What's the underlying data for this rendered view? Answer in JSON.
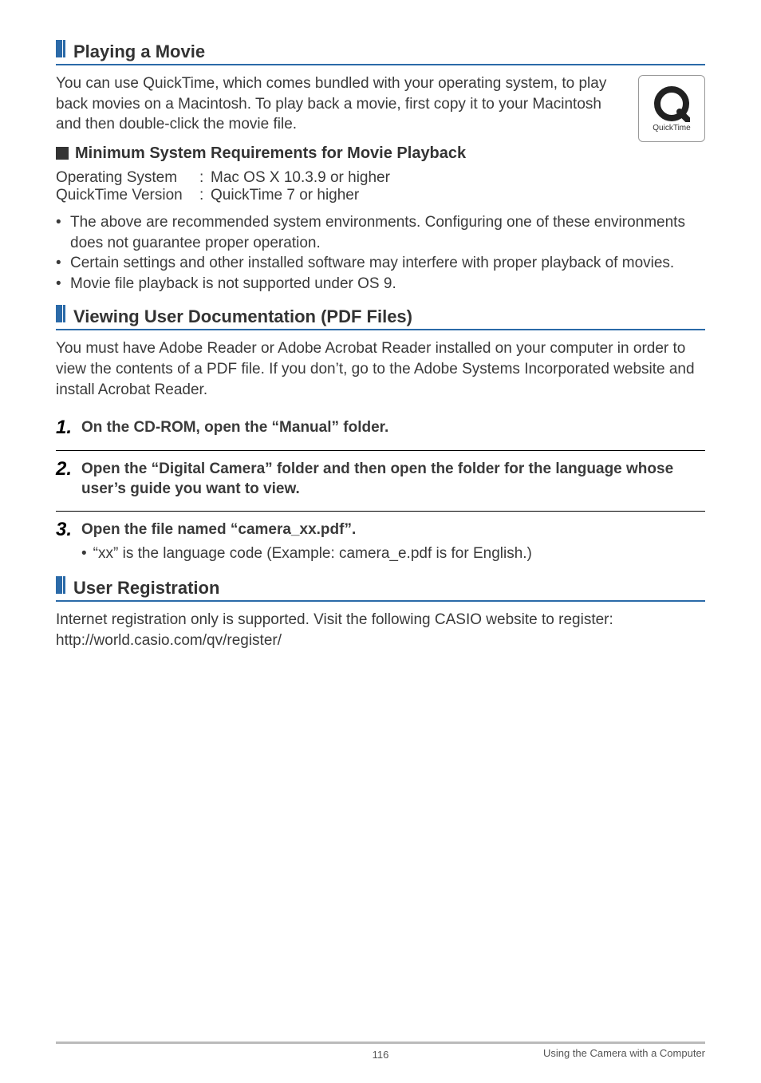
{
  "sections": {
    "playing": {
      "title": "Playing a Movie",
      "intro": "You can use QuickTime, which comes bundled with your operating system, to play back movies on a Macintosh. To play back a movie, first copy it to your Macintosh and then double-click the movie file.",
      "icon_caption": "QuickTime",
      "sub_title": "Minimum System Requirements for Movie Playback",
      "specs": [
        {
          "label": "Operating System",
          "value": "Mac OS X 10.3.9 or higher"
        },
        {
          "label": "QuickTime Version",
          "value": "QuickTime 7 or higher"
        }
      ],
      "bullets": [
        "The above are recommended system environments. Configuring one of these environments does not guarantee proper operation.",
        "Certain settings and other installed software may interfere with proper playback of movies.",
        "Movie file playback is not supported under OS 9."
      ]
    },
    "viewing": {
      "title": "Viewing User Documentation (PDF Files)",
      "intro": "You must have Adobe Reader or Adobe Acrobat Reader installed on your computer in order to view the contents of a PDF file. If you don’t, go to the Adobe Systems Incorporated website and install Acrobat Reader.",
      "steps": [
        {
          "num": "1.",
          "text": "On the CD-ROM, open the “Manual” folder."
        },
        {
          "num": "2.",
          "text": "Open the “Digital Camera” folder and then open the folder for the language whose user’s guide you want to view."
        },
        {
          "num": "3.",
          "text": "Open the file named “camera_xx.pdf”.",
          "sub": "“xx” is the language code (Example: camera_e.pdf is for English.)"
        }
      ]
    },
    "user_reg": {
      "title": "User Registration",
      "text": "Internet registration only is supported. Visit the following CASIO website to register:\nhttp://world.casio.com/qv/register/"
    }
  },
  "footer": {
    "page": "116",
    "right": "Using the Camera with a Computer"
  }
}
